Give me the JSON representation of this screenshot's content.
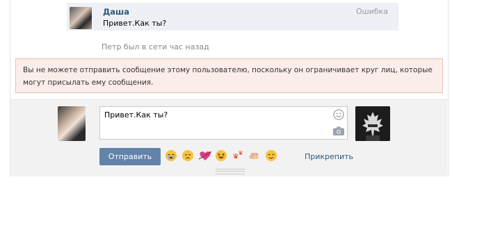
{
  "message": {
    "author": "Даша",
    "status": "Ошибка",
    "text": "Привет.Как ты?"
  },
  "last_seen": "Петр был в сети час назад",
  "error_text": "Вы не можете отправить сообщение этому пользователю, поскольку он ограничивает круг лиц, которые могут присылать ему сообщения.",
  "compose": {
    "value": "Привет.Как ты?",
    "send_label": "Отправить",
    "attach_label": "Прикрепить",
    "emojis": [
      "crying-face",
      "disappointed-face",
      "heart-with-arrow",
      "laughing-face",
      "paw-prints",
      "fist",
      "relieved-face"
    ]
  },
  "colors": {
    "link": "#2b587a",
    "button": "#6383a8",
    "message_bg": "#edf1f5",
    "error_bg": "#fbeeea",
    "error_border": "#e6c0b3",
    "compose_bg": "#f2f2f2"
  }
}
